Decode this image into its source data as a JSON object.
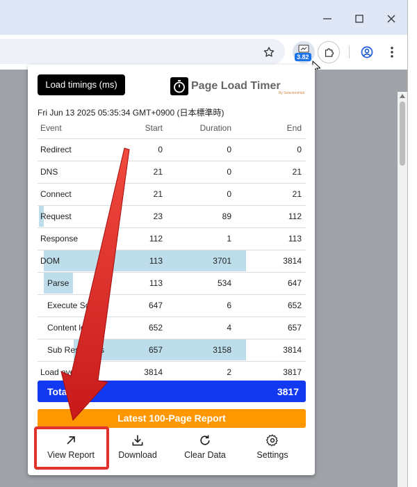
{
  "toolbar": {
    "extension_badge": "3.82"
  },
  "popup": {
    "load_timings_label": "Load timings (ms)",
    "brand_name": "Page Load Timer",
    "brand_sub": "By SelectorsHub",
    "date": "Fri Jun 13 2025 05:35:34 GMT+0900 (日本標準時)",
    "columns": {
      "event": "Event",
      "start": "Start",
      "duration": "Duration",
      "end": "End"
    },
    "rows": [
      {
        "event": "Redirect",
        "start": "0",
        "duration": "0",
        "end": "0"
      },
      {
        "event": "DNS",
        "start": "21",
        "duration": "0",
        "end": "21"
      },
      {
        "event": "Connect",
        "start": "21",
        "duration": "0",
        "end": "21"
      },
      {
        "event": "Request",
        "start": "23",
        "duration": "89",
        "end": "112"
      },
      {
        "event": "Response",
        "start": "112",
        "duration": "1",
        "end": "113"
      },
      {
        "event": "DOM",
        "start": "113",
        "duration": "3701",
        "end": "3814"
      },
      {
        "event": "Parse",
        "start": "113",
        "duration": "534",
        "end": "647"
      },
      {
        "event": "Execute Scripts",
        "start": "647",
        "duration": "6",
        "end": "652"
      },
      {
        "event": "Content loaded",
        "start": "652",
        "duration": "4",
        "end": "657"
      },
      {
        "event": "Sub Resources",
        "start": "657",
        "duration": "3158",
        "end": "3814"
      },
      {
        "event": "Load event",
        "start": "3814",
        "duration": "2",
        "end": "3817"
      }
    ],
    "total_label": "Total",
    "total_value": "3817",
    "report_label": "Latest 100-Page Report",
    "actions": {
      "view_report": "View Report",
      "download": "Download",
      "clear_data": "Clear Data",
      "settings": "Settings"
    }
  },
  "colors": {
    "total_bg": "#1238f0",
    "report_bg": "#ff9800",
    "timeline_bar": "#bcdde9",
    "highlight": "#e0312b"
  }
}
